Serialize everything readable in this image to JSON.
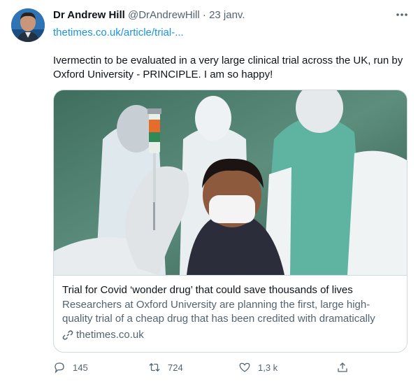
{
  "tweet": {
    "author_name": "Dr Andrew Hill",
    "handle": "@DrAndrewHill",
    "separator": "·",
    "date": "23 janv.",
    "more_icon": "more-icon",
    "link_text": "thetimes.co.uk/article/trial-...",
    "text": "Ivermectin to be evaluated in a very large clinical trial across the UK, run by Oxford University - PRINCIPLE.  I am so happy!"
  },
  "card": {
    "title": "Trial for Covid ‘wonder drug’ that could save thousands of lives",
    "description": "Researchers at Oxford University are planning the first, large high-quality trial of a cheap drug that has been credited with dramatically reducing...",
    "domain": "thetimes.co.uk",
    "domain_icon": "link-icon"
  },
  "actions": {
    "reply_count": "145",
    "retweet_count": "724",
    "like_count": "1,3 k",
    "reply_icon": "reply-icon",
    "retweet_icon": "retweet-icon",
    "like_icon": "heart-icon",
    "share_icon": "share-icon"
  },
  "colors": {
    "link": "#1b95e0",
    "secondary_text": "#536471",
    "border": "#cfd9de"
  }
}
